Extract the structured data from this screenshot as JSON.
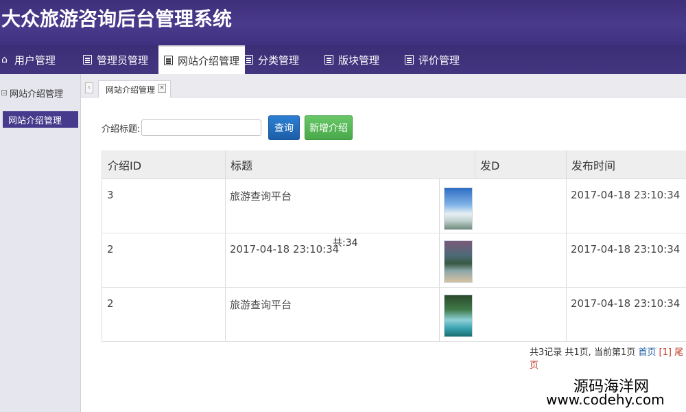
{
  "app": {
    "title": "大众旅游咨询后台管理系统"
  },
  "nav": {
    "items": [
      {
        "label": "用户管理",
        "icon": "home-icon"
      },
      {
        "label": "管理员管理",
        "icon": "list-icon"
      },
      {
        "label": "网站介绍管理",
        "icon": "list-icon",
        "active": true
      },
      {
        "label": "分类管理",
        "icon": "list-icon"
      },
      {
        "label": "版块管理",
        "icon": "list-icon"
      },
      {
        "label": "评价管理",
        "icon": "list-icon"
      }
    ]
  },
  "sidebar": {
    "header": "网站介绍管理",
    "items": [
      {
        "label": "网站介绍管理",
        "active": true
      }
    ]
  },
  "tab": {
    "label": "网站介绍管理",
    "close": "×",
    "scroll": "‹"
  },
  "search": {
    "label": "介绍标题:",
    "value": "",
    "placeholder": ""
  },
  "buttons": {
    "query": "查询",
    "add": "新增介绍"
  },
  "table": {
    "headers": [
      "介绍ID",
      "标题",
      "发D",
      "发布时间"
    ],
    "rows": [
      {
        "id": "3",
        "title": "旅游查询平台",
        "image": "beach-thumbnail",
        "time": "2017-04-18 23:10:34"
      },
      {
        "id": "2",
        "title": "2017-04-18 23:10:34",
        "image": "coast-thumbnail",
        "time": "2017-04-18 23:10:34"
      },
      {
        "id": "2",
        "title": "旅游查询平台",
        "image": "waterfall-thumbnail",
        "time": "2017-04-18 23:10:34"
      }
    ],
    "overlay": "共:34"
  },
  "pagination": {
    "summary": "共3记录 共1页, 当前第1页",
    "first": "首页",
    "current": "[1]",
    "last": "尾页"
  },
  "watermark": {
    "line1": "源码海洋网",
    "line2": "www.codehy.com"
  },
  "colors": {
    "header": "#3e2f7a",
    "nav": "#43357f",
    "sidebar_active": "#463a8c",
    "query_button": "#2b7fd3",
    "add_button": "#5cb85c",
    "link": "#2060a8",
    "current_page": "#c0392b"
  }
}
